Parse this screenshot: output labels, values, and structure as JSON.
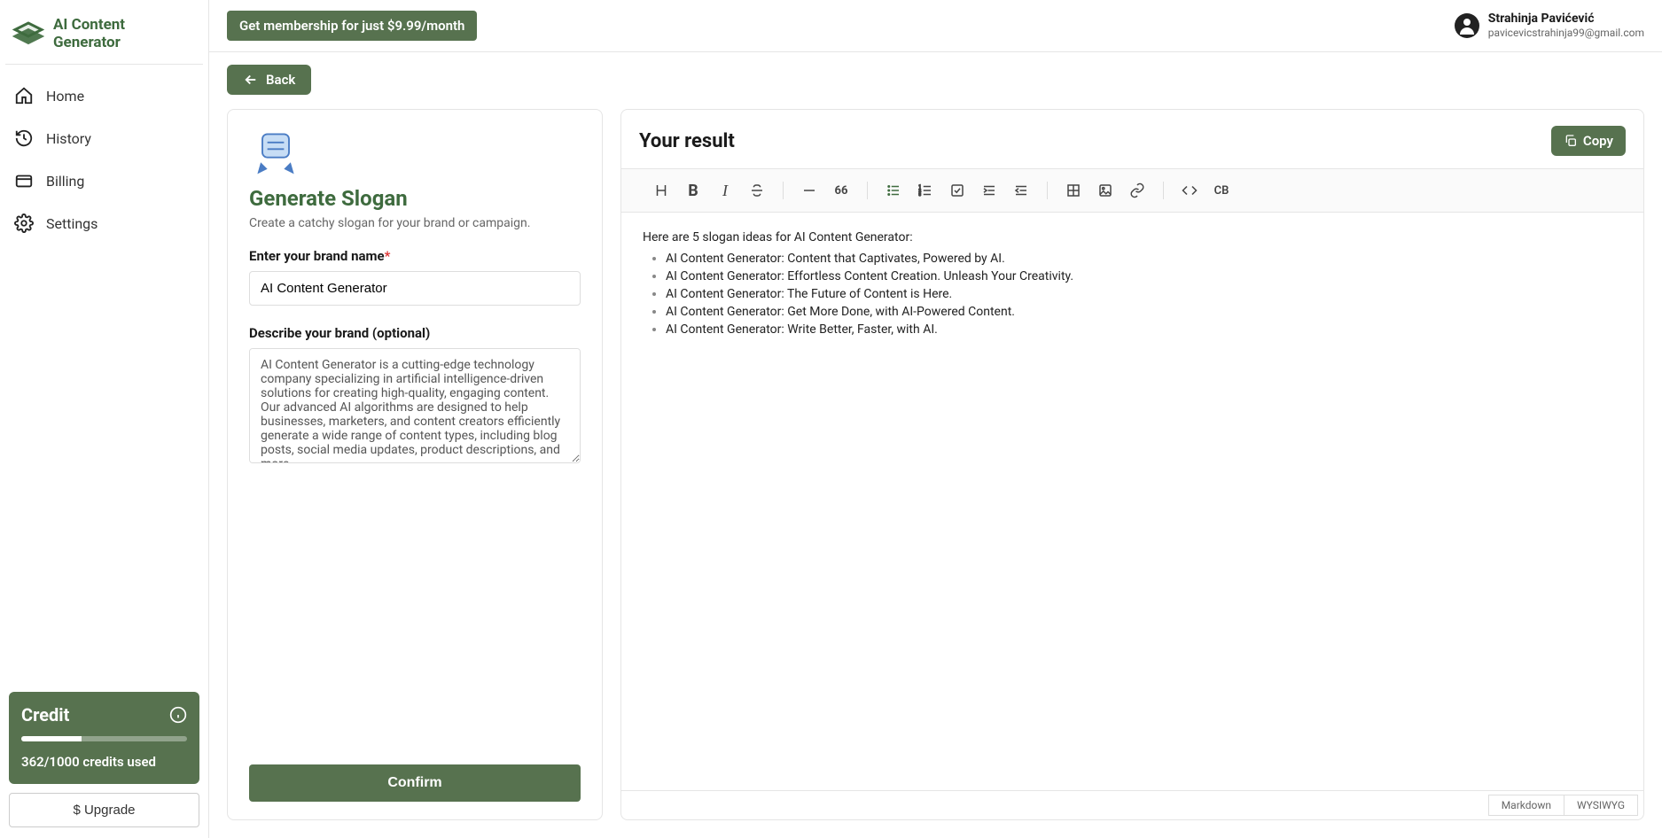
{
  "brand": {
    "name": "AI Content Generator"
  },
  "sidebar": {
    "items": [
      {
        "label": "Home"
      },
      {
        "label": "History"
      },
      {
        "label": "Billing"
      },
      {
        "label": "Settings"
      }
    ]
  },
  "credit": {
    "title": "Credit",
    "used": 362,
    "total": 1000,
    "text": "362/1000 credits used"
  },
  "upgrade": {
    "label": "$ Upgrade"
  },
  "topbar": {
    "promo": "Get membership for just $9.99/month",
    "user": {
      "name": "Strahinja Pavićević",
      "email": "pavicevicstrahinja99@gmail.com"
    }
  },
  "back": {
    "label": "Back"
  },
  "form": {
    "title": "Generate Slogan",
    "subtitle": "Create a catchy slogan for your brand or campaign.",
    "brand_label": "Enter your brand name",
    "brand_value": "AI Content Generator",
    "desc_label": "Describe your brand (optional)",
    "desc_value": "AI Content Generator is a cutting-edge technology company specializing in artificial intelligence-driven solutions for creating high-quality, engaging content. Our advanced AI algorithms are designed to help businesses, marketers, and content creators efficiently generate a wide range of content types, including blog posts, social media updates, product descriptions, and more.",
    "confirm": "Confirm"
  },
  "result": {
    "title": "Your result",
    "copy": "Copy",
    "intro": "Here are 5 slogan ideas for AI Content Generator:",
    "items": [
      "AI Content Generator:  Content that Captivates, Powered by AI.",
      "AI Content Generator:  Effortless Content Creation. Unleash Your Creativity.",
      "AI Content Generator:  The Future of Content is Here.",
      "AI Content Generator:  Get More Done, with AI-Powered Content.",
      "AI Content Generator:  Write Better, Faster, with AI."
    ],
    "footer": {
      "md": "Markdown",
      "wys": "WYSIWYG"
    }
  },
  "toolbar": {
    "quote": "66",
    "cb": "CB"
  }
}
